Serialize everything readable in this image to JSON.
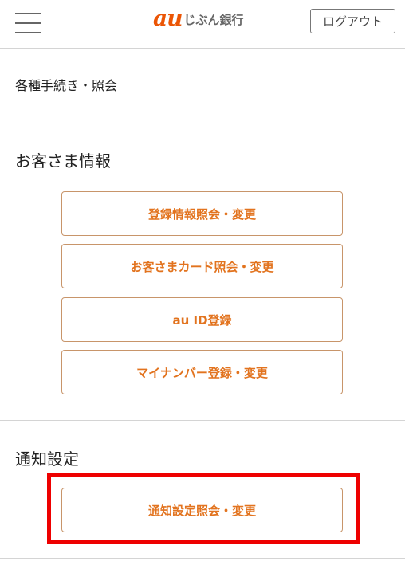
{
  "header": {
    "logo_mark": "au",
    "logo_text": "じぶん銀行",
    "logout_label": "ログアウト",
    "brand_color": "#eb5505"
  },
  "breadcrumb": {
    "label": "各種手続き・照会"
  },
  "customer_info": {
    "title": "お客さま情報",
    "buttons": [
      {
        "label": "登録情報照会・変更"
      },
      {
        "label": "お客さまカード照会・変更"
      },
      {
        "label": "au ID登録"
      },
      {
        "label": "マイナンバー登録・変更"
      }
    ]
  },
  "notification": {
    "title": "通知設定",
    "buttons": [
      {
        "label": "通知設定照会・変更"
      }
    ]
  },
  "colors": {
    "button_text": "#e2731e",
    "button_border": "#c8956a",
    "highlight": "#ee0000"
  }
}
